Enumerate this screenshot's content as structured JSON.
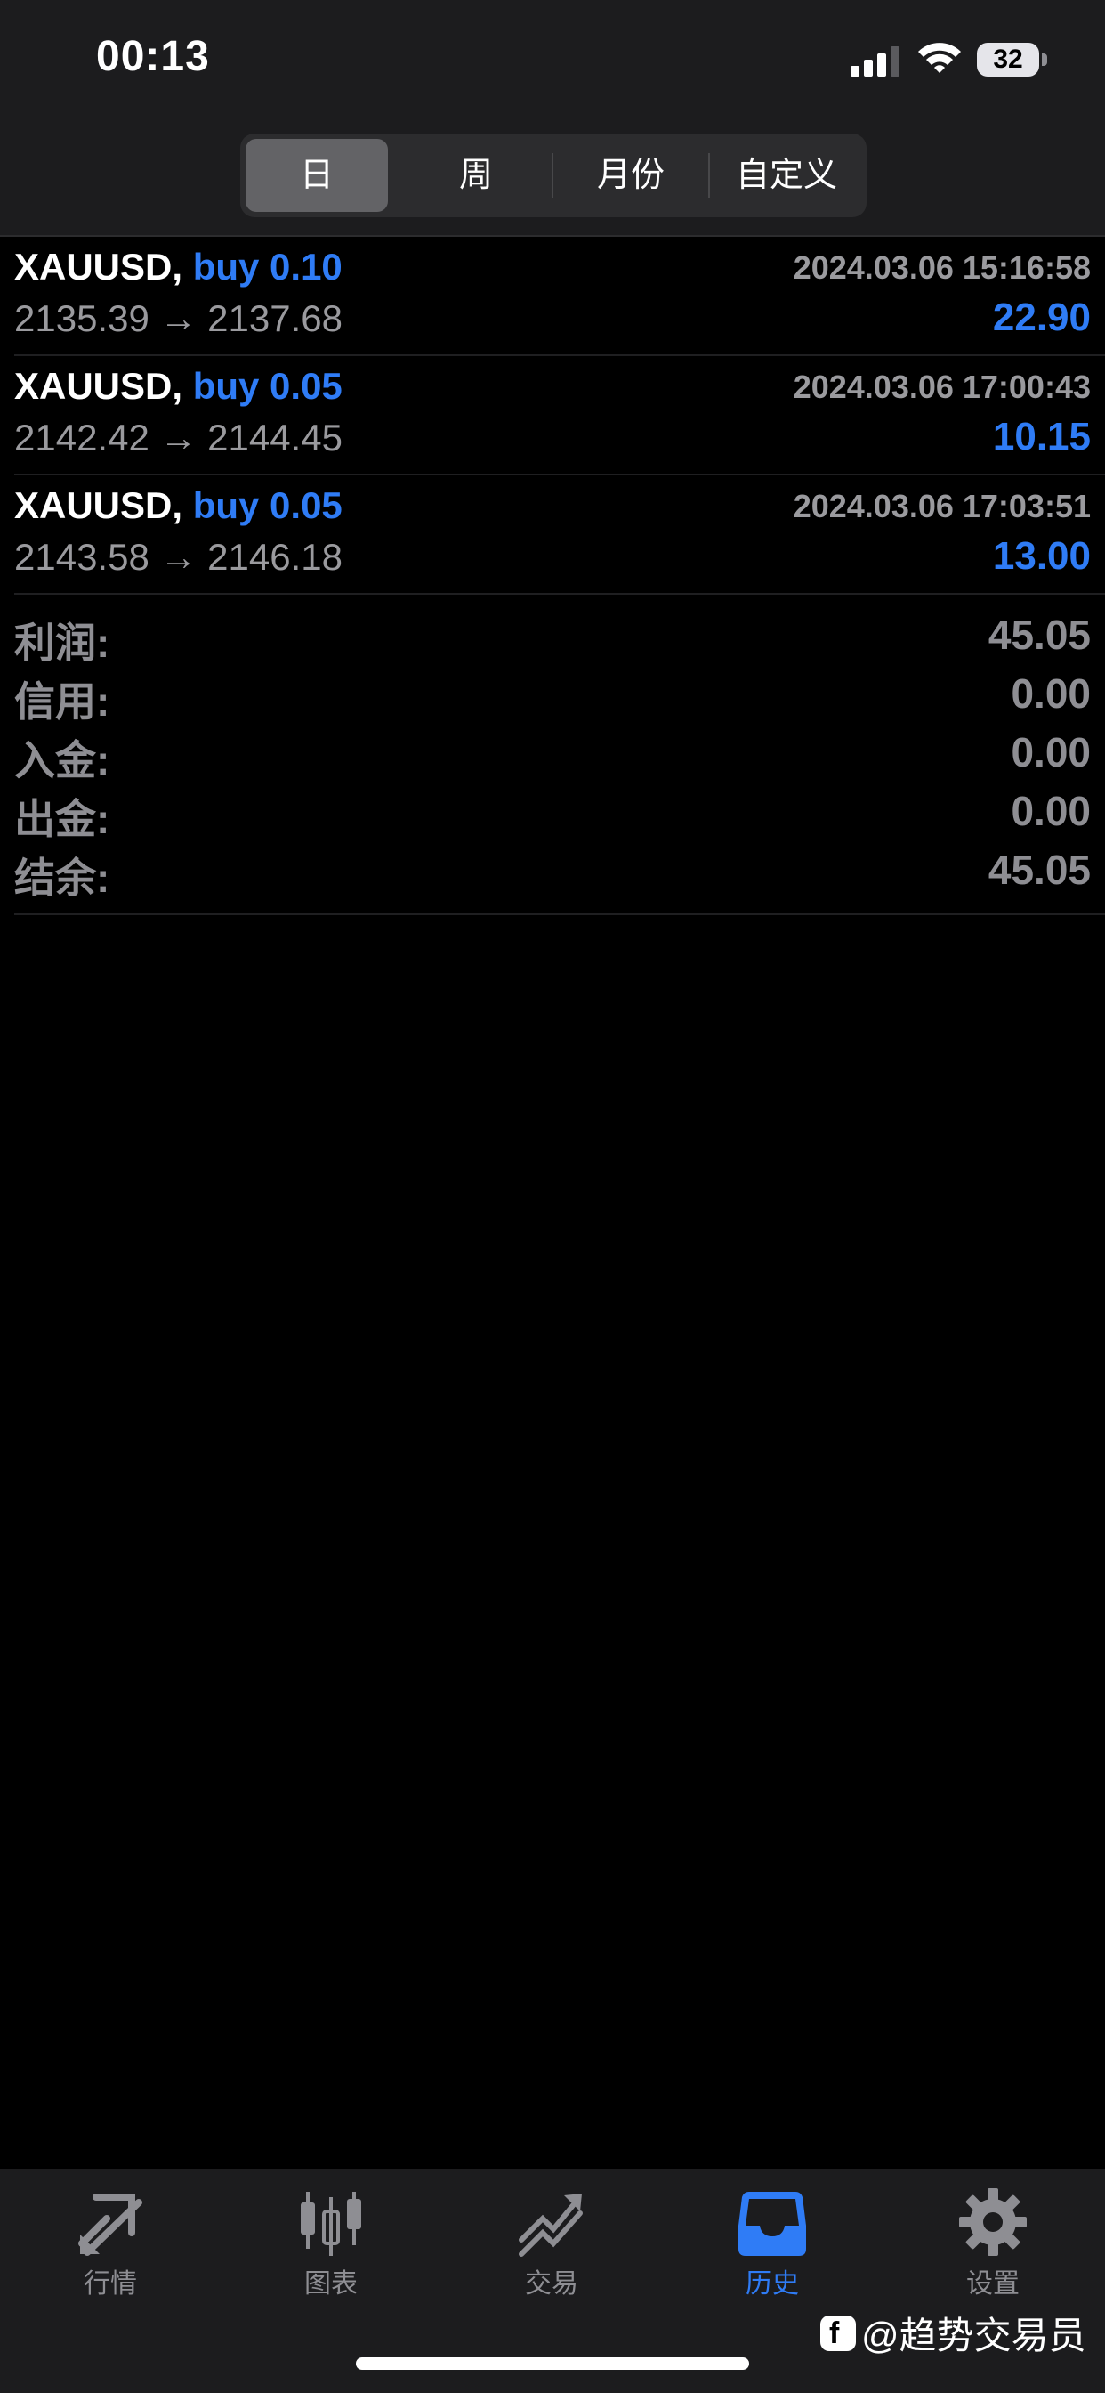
{
  "status_bar": {
    "time": "00:13",
    "battery": "32"
  },
  "period_tabs": [
    {
      "label": "日",
      "active": true
    },
    {
      "label": "周",
      "active": false
    },
    {
      "label": "月份",
      "active": false
    },
    {
      "label": "自定义",
      "active": false
    }
  ],
  "trades": [
    {
      "symbol": "XAUUSD,",
      "side": "buy 0.10",
      "time": "2024.03.06 15:16:58",
      "prices": "2135.39 → 2137.68",
      "profit": "22.90"
    },
    {
      "symbol": "XAUUSD,",
      "side": "buy 0.05",
      "time": "2024.03.06 17:00:43",
      "prices": "2142.42 → 2144.45",
      "profit": "10.15"
    },
    {
      "symbol": "XAUUSD,",
      "side": "buy 0.05",
      "time": "2024.03.06 17:03:51",
      "prices": "2143.58 → 2146.18",
      "profit": "13.00"
    }
  ],
  "summary": [
    {
      "label": "利润:",
      "value": "45.05"
    },
    {
      "label": "信用:",
      "value": "0.00"
    },
    {
      "label": "入金:",
      "value": "0.00"
    },
    {
      "label": "出金:",
      "value": "0.00"
    },
    {
      "label": "结余:",
      "value": "45.05"
    }
  ],
  "tab_bar": [
    {
      "label": "行情",
      "icon": "quotes-icon",
      "active": false
    },
    {
      "label": "图表",
      "icon": "chart-candles-icon",
      "active": false
    },
    {
      "label": "交易",
      "icon": "trade-icon",
      "active": false
    },
    {
      "label": "历史",
      "icon": "history-tray-icon",
      "active": true
    },
    {
      "label": "设置",
      "icon": "gear-icon",
      "active": false
    }
  ],
  "watermark": {
    "text": "@趋势交易员"
  },
  "colors": {
    "accent": "#2f7cf6",
    "muted": "#8e8e93",
    "background": "#000000",
    "bar": "#1c1c1e"
  }
}
